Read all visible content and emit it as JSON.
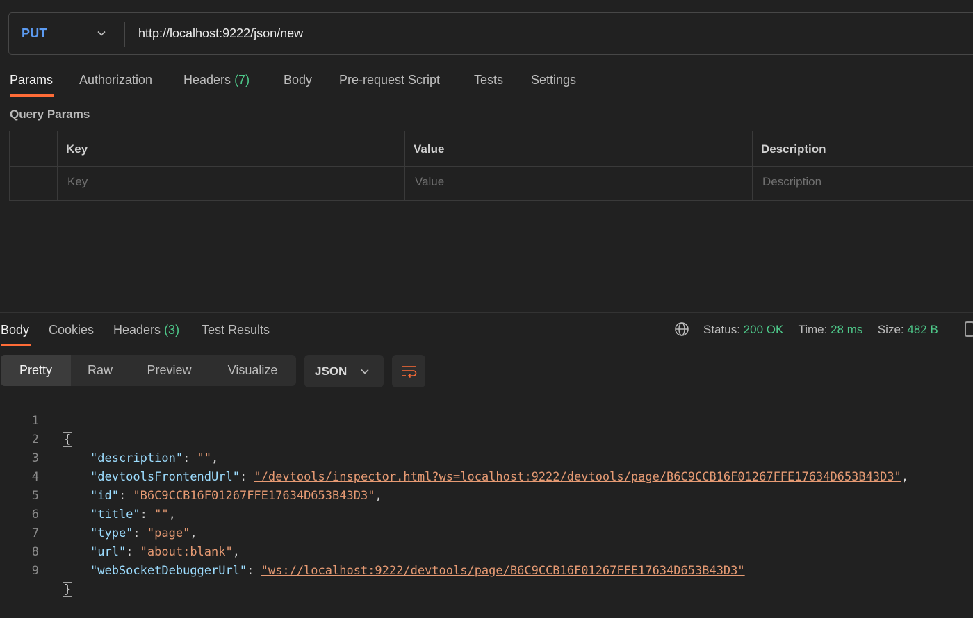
{
  "request": {
    "method": "PUT",
    "url": "http://localhost:9222/json/new"
  },
  "request_tabs": [
    {
      "label": "Params",
      "count": ""
    },
    {
      "label": "Authorization",
      "count": ""
    },
    {
      "label": "Headers",
      "count": "(7)"
    },
    {
      "label": "Body",
      "count": ""
    },
    {
      "label": "Pre-request Script",
      "count": ""
    },
    {
      "label": "Tests",
      "count": ""
    },
    {
      "label": "Settings",
      "count": ""
    }
  ],
  "query_params": {
    "title": "Query Params",
    "columns": [
      "Key",
      "Value",
      "Description"
    ],
    "placeholders": [
      "Key",
      "Value",
      "Description"
    ]
  },
  "response_tabs": [
    {
      "label": "Body",
      "count": ""
    },
    {
      "label": "Cookies",
      "count": ""
    },
    {
      "label": "Headers",
      "count": "(3)"
    },
    {
      "label": "Test Results",
      "count": ""
    }
  ],
  "status": {
    "status_label": "Status:",
    "status_value": "200 OK",
    "time_label": "Time:",
    "time_value": "28 ms",
    "size_label": "Size:",
    "size_value": "482 B"
  },
  "view_modes": [
    "Pretty",
    "Raw",
    "Preview",
    "Visualize"
  ],
  "format": "JSON",
  "code_lines": [
    {
      "n": "1",
      "key": "",
      "value": "",
      "trail": ""
    },
    {
      "n": "2",
      "key": "\"description\"",
      "value": "\"\"",
      "trail": ","
    },
    {
      "n": "3",
      "key": "\"devtoolsFrontendUrl\"",
      "value": "\"/devtools/inspector.html?ws=localhost:9222/devtools/page/B6C9CCB16F01267FFE17634D653B43D3\"",
      "trail": ","
    },
    {
      "n": "4",
      "key": "\"id\"",
      "value": "\"B6C9CCB16F01267FFE17634D653B43D3\"",
      "trail": ","
    },
    {
      "n": "5",
      "key": "\"title\"",
      "value": "\"\"",
      "trail": ","
    },
    {
      "n": "6",
      "key": "\"type\"",
      "value": "\"page\"",
      "trail": ","
    },
    {
      "n": "7",
      "key": "\"url\"",
      "value": "\"about:blank\"",
      "trail": ","
    },
    {
      "n": "8",
      "key": "\"webSocketDebuggerUrl\"",
      "value": "\"ws://localhost:9222/devtools/page/B6C9CCB16F01267FFE17634D653B43D3\"",
      "trail": ""
    },
    {
      "n": "9",
      "key": "",
      "value": "",
      "trail": ""
    }
  ],
  "code_braces": {
    "open": "{",
    "close": "}"
  },
  "colors": {
    "accent": "#ff6c37",
    "method": "#5c9bf2",
    "success": "#4ec98a",
    "json_key": "#9cdcfe",
    "json_string": "#e69a73"
  }
}
